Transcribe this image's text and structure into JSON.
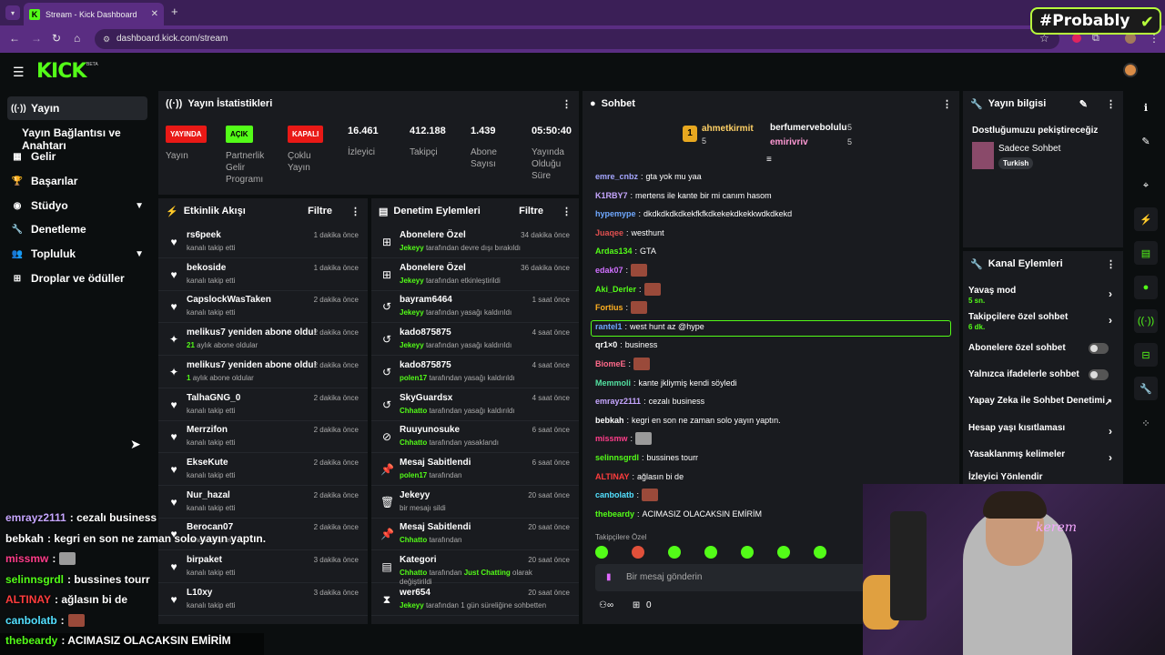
{
  "browser": {
    "tab_title": "Stream - Kick Dashboard",
    "url": "dashboard.kick.com/stream",
    "overlay_logo": "#Probably"
  },
  "header": {
    "logo": "KICK",
    "beta": "BETA"
  },
  "sidebar": {
    "items": [
      {
        "label": "Yayın",
        "icon": "broadcast-icon"
      },
      {
        "label": "Yayın Bağlantısı ve Anahtarı",
        "icon": ""
      },
      {
        "label": "Gelir",
        "icon": "wallet-icon"
      },
      {
        "label": "Başarılar",
        "icon": "trophy-icon"
      },
      {
        "label": "Stüdyo",
        "icon": "studio-icon"
      },
      {
        "label": "Denetleme",
        "icon": "wrench-icon"
      },
      {
        "label": "Topluluk",
        "icon": "users-icon"
      },
      {
        "label": "Droplar ve ödüller",
        "icon": "gift-icon"
      }
    ]
  },
  "stats": {
    "title": "Yayın İstatistikleri",
    "items": [
      {
        "badge": "YAYINDA",
        "label": "Yayın"
      },
      {
        "badge": "AÇIK",
        "label": "Partnerlik Gelir Programı"
      },
      {
        "badge": "KAPALI",
        "label": "Çoklu Yayın"
      },
      {
        "value": "16.461",
        "label": "İzleyici"
      },
      {
        "value": "412.188",
        "label": "Takipçi"
      },
      {
        "value": "1.439",
        "label": "Abone Sayısı"
      },
      {
        "value": "05:50:40",
        "label": "Yayında Olduğu Süre"
      }
    ]
  },
  "feed": {
    "title": "Etkinlik Akışı",
    "filter": "Filtre",
    "rows": [
      {
        "name": "rs6peek",
        "sub": "kanalı takip etti",
        "time": "1 dakika önce",
        "icon": "heart"
      },
      {
        "name": "bekoside",
        "sub": "kanalı takip etti",
        "time": "1 dakika önce",
        "icon": "heart"
      },
      {
        "name": "CapslockWasTaken",
        "sub": "kanalı takip etti",
        "time": "2 dakika önce",
        "icon": "heart"
      },
      {
        "name": "melikus7 yeniden abone oldu!",
        "subg": "21",
        "sub": "aylık abone oldular",
        "time": "2 dakika önce",
        "icon": "star"
      },
      {
        "name": "melikus7 yeniden abone oldu!",
        "subg": "1",
        "sub": "aylık abone oldular",
        "time": "2 dakika önce",
        "icon": "star"
      },
      {
        "name": "TalhaGNG_0",
        "sub": "kanalı takip etti",
        "time": "2 dakika önce",
        "icon": "heart"
      },
      {
        "name": "Merrzifon",
        "sub": "kanalı takip etti",
        "time": "2 dakika önce",
        "icon": "heart"
      },
      {
        "name": "EkseKute",
        "sub": "kanalı takip etti",
        "time": "2 dakika önce",
        "icon": "heart"
      },
      {
        "name": "Nur_hazal",
        "sub": "kanalı takip etti",
        "time": "2 dakika önce",
        "icon": "heart"
      },
      {
        "name": "Berocan07",
        "sub": "kanalı takip etti",
        "time": "2 dakika önce",
        "icon": "heart"
      },
      {
        "name": "birpaket",
        "sub": "kanalı takip etti",
        "time": "3 dakika önce",
        "icon": "heart"
      },
      {
        "name": "L10xy",
        "sub": "kanalı takip etti",
        "time": "3 dakika önce",
        "icon": "heart"
      }
    ]
  },
  "mod": {
    "title": "Denetim Eylemleri",
    "filter": "Filtre",
    "rows": [
      {
        "name": "Abonelere Özel",
        "user": "Jekeyy",
        "sub": "tarafından devre dışı bırakıldı",
        "time": "34 dakika önce",
        "icon": "gift"
      },
      {
        "name": "Abonelere Özel",
        "user": "Jekeyy",
        "sub": "tarafından etkinleştirildi",
        "time": "36 dakika önce",
        "icon": "gift"
      },
      {
        "name": "bayram6464",
        "user": "Jekeyy",
        "sub": "tarafından yasağı kaldırıldı",
        "time": "1 saat önce",
        "icon": "undo"
      },
      {
        "name": "kado875875",
        "user": "Jekeyy",
        "sub": "tarafından yasağı kaldırıldı",
        "time": "4 saat önce",
        "icon": "undo"
      },
      {
        "name": "kado875875",
        "user": "polen17",
        "sub": "tarafından yasağı kaldırıldı",
        "time": "4 saat önce",
        "icon": "undo"
      },
      {
        "name": "SkyGuardsx",
        "user": "Chhatto",
        "sub": "tarafından yasağı kaldırıldı",
        "time": "4 saat önce",
        "icon": "undo"
      },
      {
        "name": "Ruuyunosuke",
        "user": "Chhatto",
        "sub": "tarafından yasaklandı",
        "time": "6 saat önce",
        "icon": "ban"
      },
      {
        "name": "Mesaj Sabitlendi",
        "user": "polen17",
        "sub": "tarafından",
        "time": "6 saat önce",
        "icon": "pin"
      },
      {
        "name": "Jekeyy",
        "user": "",
        "sub": "bir mesajı sildi",
        "time": "20 saat önce",
        "icon": "trash"
      },
      {
        "name": "Mesaj Sabitlendi",
        "user": "Chhatto",
        "sub": "tarafından",
        "time": "20 saat önce",
        "icon": "pin"
      },
      {
        "name": "Kategori",
        "user": "Chhatto",
        "sub": "tarafından Just Chatting olarak değiştirildi",
        "time": "20 saat önce",
        "icon": "category"
      },
      {
        "name": "wer654",
        "user": "Jekeyy",
        "sub": "tarafından 1 gün süreliğine sohbetten",
        "time": "20 saat önce",
        "icon": "hourglass"
      }
    ]
  },
  "chat": {
    "title": "Sohbet",
    "pinned": [
      {
        "rank": "1",
        "name": "ahmetkirmit",
        "count": "5"
      },
      {
        "name": "berfumervebolulu",
        "count": "5"
      },
      {
        "name": "emirivriv",
        "count": "5"
      }
    ],
    "messages": [
      {
        "user": "emre_cnbz",
        "color": "#a5a6ff",
        "text": "gta yok mu yaa"
      },
      {
        "user": "K1RBY7",
        "color": "#c6a6ff",
        "text": "mertens ile kante bir mi canım hasom"
      },
      {
        "user": "hypemype",
        "color": "#6fa8ff",
        "text": "dkdkdkdkdkekfkfkdkekekdkekkwdkdkekd"
      },
      {
        "user": "Juaqee",
        "color": "#e05050",
        "text": "westhunt"
      },
      {
        "user": "Ardas134",
        "color": "#53fc18",
        "text": "GTA"
      },
      {
        "user": "edak07",
        "color": "#d070ff",
        "text": "",
        "emote": true
      },
      {
        "user": "Aki_Derler",
        "color": "#53fc18",
        "text": "",
        "emote": true
      },
      {
        "user": "Fortius",
        "color": "#ffb020",
        "text": "",
        "emote": true
      },
      {
        "user": "rantel1",
        "color": "#6fa8ff",
        "text": "west hunt az @hype"
      },
      {
        "user": "qr1×0",
        "color": "#ffffff",
        "text": "business"
      },
      {
        "user": "BiomeE",
        "color": "#ff6a8a",
        "text": "",
        "emote": true
      },
      {
        "user": "Memmoli",
        "color": "#53e0a0",
        "text": "kante jkliymiş kendi söyledi"
      },
      {
        "user": "emrayz2111",
        "color": "#c6a6ff",
        "text": "cezalı business"
      },
      {
        "user": "bebkah",
        "color": "#ffffff",
        "text": "kegri en son ne zaman solo yayın yaptın."
      },
      {
        "user": "missmw",
        "color": "#ff3d8a",
        "text": "",
        "emote": true
      },
      {
        "user": "selinnsgrdl",
        "color": "#53fc18",
        "text": "bussines tourr"
      },
      {
        "user": "ALTINAY",
        "color": "#ff3d3d",
        "text": "ağlasın bi de"
      },
      {
        "user": "canbolatb",
        "color": "#53e0ff",
        "text": "",
        "emote": true
      },
      {
        "user": "thebeardy",
        "color": "#53fc18",
        "text": "ACIMASIZ OLACAKSIN EMİRİM"
      }
    ],
    "sub_only_label": "Takipçilere Özel",
    "input_placeholder": "Bir mesaj gönderin",
    "footer_count": "0"
  },
  "info": {
    "title": "Yayın bilgisi",
    "stream_title": "Dostluğumuzu pekiştireceğiz",
    "category": "Sadece Sohbet",
    "language": "Turkish"
  },
  "actions": {
    "title": "Kanal Eylemleri",
    "rows": [
      {
        "label": "Yavaş mod",
        "sub": "5 sn.",
        "type": "chev"
      },
      {
        "label": "Takipçilere özel sohbet",
        "sub": "6 dk.",
        "type": "chev"
      },
      {
        "label": "Abonelere özel sohbet",
        "sub": "",
        "type": "toggle"
      },
      {
        "label": "Yalnızca ifadelerle sohbet",
        "sub": "",
        "type": "toggle"
      },
      {
        "label": "Yapay Zeka ile Sohbet Denetimi",
        "sub": "",
        "type": "ext"
      },
      {
        "label": "Hesap yaşı kısıtlaması",
        "sub": "",
        "type": "chev"
      },
      {
        "label": "Yasaklanmış kelimeler",
        "sub": "",
        "type": "chev"
      },
      {
        "label": "İzleyici Yönlendir",
        "sub": "",
        "type": "none"
      }
    ]
  },
  "overlay_chat": [
    {
      "user": "emrayz2111",
      "color": "#c6a6ff",
      "text": ": cezalı business"
    },
    {
      "user": "bebkah",
      "color": "#ffffff",
      "text": ": kegri en son ne zaman solo yayın yaptın."
    },
    {
      "user": "missmw",
      "color": "#ff3d8a",
      "text": ":",
      "emote": true
    },
    {
      "user": "selinnsgrdl",
      "color": "#53fc18",
      "text": ": bussines tourr"
    },
    {
      "user": "ALTINAY",
      "color": "#ff3d3d",
      "text": ": ağlasın bi de"
    },
    {
      "user": "canbolatb",
      "color": "#53e0ff",
      "text": ":",
      "emote": true
    },
    {
      "user": "thebeardy",
      "color": "#53fc18",
      "text": ": ACIMASIZ OLACAKSIN EMİRİM"
    }
  ],
  "webcam": {
    "neon_sign": "kerem"
  },
  "colors": {
    "accent": "#53fc18",
    "panel": "#191b1f",
    "live": "#e91916"
  }
}
